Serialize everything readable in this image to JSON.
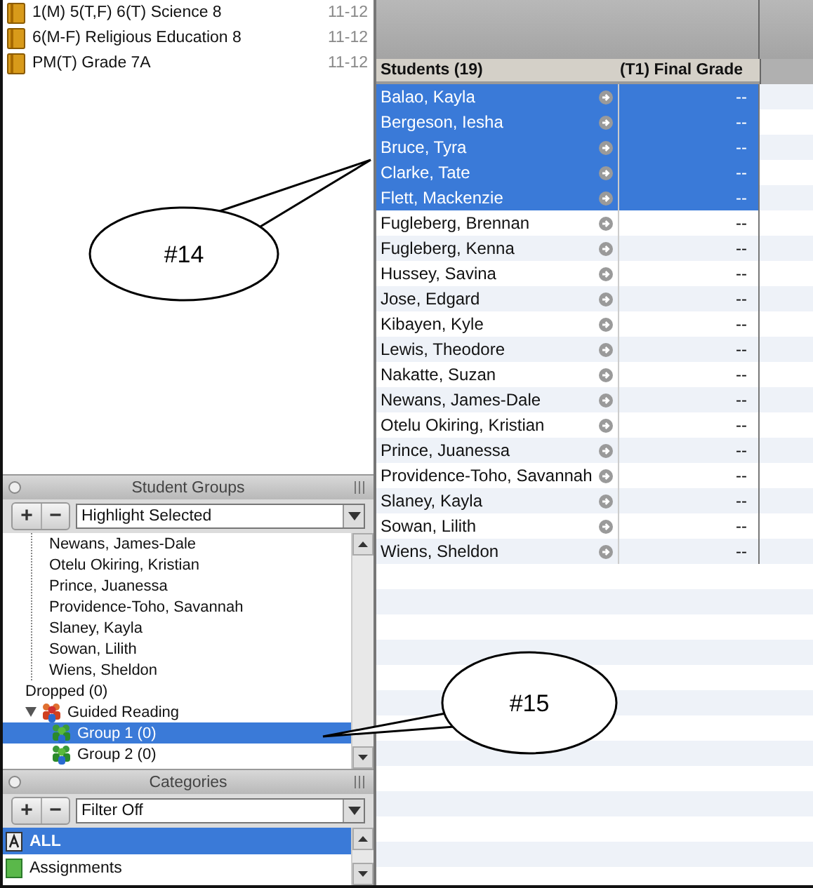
{
  "courses": [
    {
      "name": "1(M) 5(T,F) 6(T) Science 8",
      "term": "11-12"
    },
    {
      "name": "6(M-F) Religious Education 8",
      "term": "11-12"
    },
    {
      "name": "PM(T) Grade 7A",
      "term": "11-12"
    }
  ],
  "student_groups": {
    "title": "Student Groups",
    "add": "+",
    "remove": "−",
    "filter": "Highlight Selected",
    "scrolled_members": [
      "Newans, James-Dale",
      "Otelu Okiring, Kristian",
      "Prince, Juanessa",
      "Providence-Toho, Savannah",
      "Slaney, Kayla",
      "Sowan, Lilith",
      "Wiens, Sheldon"
    ],
    "tree": [
      {
        "label": "Dropped (0)",
        "kind": "folder",
        "selected": false
      },
      {
        "label": "Guided Reading",
        "kind": "group",
        "expanded": true,
        "selected": false,
        "children": [
          {
            "label": "Group 1 (0)",
            "kind": "group",
            "selected": true
          },
          {
            "label": "Group 2 (0)",
            "kind": "group",
            "selected": false
          }
        ]
      }
    ]
  },
  "categories": {
    "title": "Categories",
    "add": "+",
    "remove": "−",
    "filter": "Filter Off",
    "items": [
      {
        "label": "ALL",
        "kind": "all",
        "selected": true
      },
      {
        "label": "Assignments",
        "kind": "assignments",
        "selected": false
      }
    ]
  },
  "table": {
    "columns": [
      "Students (19)",
      "(T1) Final Grade"
    ],
    "rows": [
      {
        "name": "Balao, Kayla",
        "grade": "--",
        "selected": true
      },
      {
        "name": "Bergeson, Iesha",
        "grade": "--",
        "selected": true
      },
      {
        "name": "Bruce, Tyra",
        "grade": "--",
        "selected": true
      },
      {
        "name": "Clarke, Tate",
        "grade": "--",
        "selected": true
      },
      {
        "name": "Flett, Mackenzie",
        "grade": "--",
        "selected": true
      },
      {
        "name": "Fugleberg, Brennan",
        "grade": "--",
        "selected": false
      },
      {
        "name": "Fugleberg, Kenna",
        "grade": "--",
        "selected": false
      },
      {
        "name": "Hussey, Savina",
        "grade": "--",
        "selected": false
      },
      {
        "name": "Jose, Edgard",
        "grade": "--",
        "selected": false
      },
      {
        "name": "Kibayen, Kyle",
        "grade": "--",
        "selected": false
      },
      {
        "name": "Lewis, Theodore",
        "grade": "--",
        "selected": false
      },
      {
        "name": "Nakatte, Suzan",
        "grade": "--",
        "selected": false
      },
      {
        "name": "Newans, James-Dale",
        "grade": "--",
        "selected": false
      },
      {
        "name": "Otelu Okiring, Kristian",
        "grade": "--",
        "selected": false
      },
      {
        "name": "Prince, Juanessa",
        "grade": "--",
        "selected": false
      },
      {
        "name": "Providence-Toho, Savannah",
        "grade": "--",
        "selected": false
      },
      {
        "name": "Slaney, Kayla",
        "grade": "--",
        "selected": false
      },
      {
        "name": "Sowan, Lilith",
        "grade": "--",
        "selected": false
      },
      {
        "name": "Wiens, Sheldon",
        "grade": "--",
        "selected": false
      }
    ]
  },
  "callouts": [
    {
      "label": "#14"
    },
    {
      "label": "#15"
    }
  ]
}
